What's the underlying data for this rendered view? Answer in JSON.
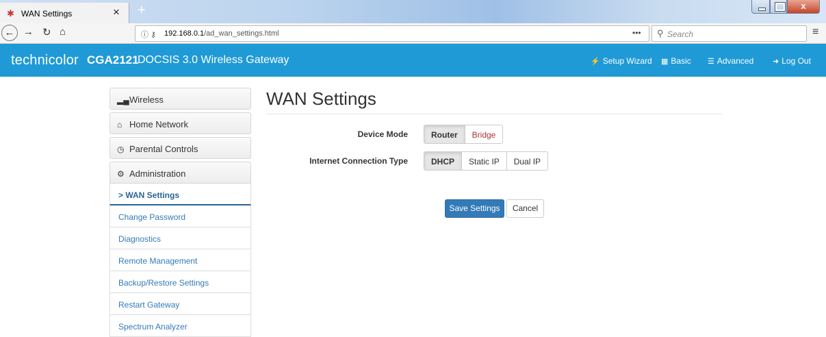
{
  "browser": {
    "tab_title": "WAN Settings",
    "url_host": "192.168.0.1",
    "url_path": "/ad_wan_settings.html",
    "url_dots": "•••",
    "search_placeholder": "Search",
    "close_glyph": "×",
    "newtab_glyph": "+",
    "window_close_glyph": "x"
  },
  "header": {
    "brand": "technicolor",
    "model": "CGA2121",
    "description": "DOCSIS 3.0 Wireless Gateway",
    "nav": {
      "setup_wizard": "Setup Wizard",
      "basic": "Basic",
      "advanced": "Advanced",
      "logout": "Log Out"
    }
  },
  "sidebar": {
    "sections": [
      {
        "label": "Wireless",
        "icon": "signal-icon"
      },
      {
        "label": "Home Network",
        "icon": "home-icon"
      },
      {
        "label": "Parental Controls",
        "icon": "clock-icon"
      },
      {
        "label": "Administration",
        "icon": "gear-icon"
      }
    ],
    "items": [
      {
        "label": "> WAN Settings",
        "active": true
      },
      {
        "label": "Change Password"
      },
      {
        "label": "Diagnostics"
      },
      {
        "label": "Remote Management"
      },
      {
        "label": "Backup/Restore Settings"
      },
      {
        "label": "Restart Gateway"
      },
      {
        "label": "Spectrum Analyzer"
      }
    ]
  },
  "main": {
    "title": "WAN Settings",
    "device_mode": {
      "label": "Device Mode",
      "options": [
        "Router",
        "Bridge"
      ],
      "selected": "Router"
    },
    "connection_type": {
      "label": "Internet Connection Type",
      "options": [
        "DHCP",
        "Static IP",
        "Dual IP"
      ],
      "selected": "DHCP"
    },
    "save_label": "Save Settings",
    "cancel_label": "Cancel"
  },
  "colors": {
    "brand_blue": "#1f9ad6",
    "primary_button": "#337ab7",
    "link": "#337ab7",
    "bridge_text": "#a33333"
  }
}
